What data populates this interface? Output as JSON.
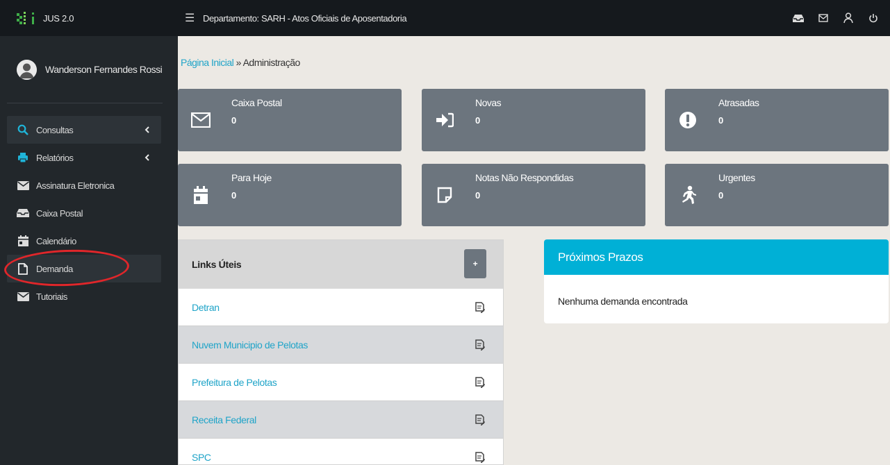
{
  "app": {
    "title": "JUS 2.0"
  },
  "header": {
    "department": "Departamento: SARH - Atos Oficiais de Aposentadoria"
  },
  "user": {
    "name": "Wanderson Fernandes Rossi"
  },
  "sidebar": {
    "items": [
      {
        "label": "Consultas",
        "icon": "search-icon"
      },
      {
        "label": "Relatórios",
        "icon": "printer-icon"
      },
      {
        "label": "Assinatura Eletronica",
        "icon": "envelope-icon"
      },
      {
        "label": "Caixa Postal",
        "icon": "inbox-icon"
      },
      {
        "label": "Calendário",
        "icon": "calendar-icon"
      },
      {
        "label": "Demanda",
        "icon": "document-icon"
      },
      {
        "label": "Tutoriais",
        "icon": "envelope-icon"
      }
    ]
  },
  "breadcrumb": {
    "home": "Página Inicial",
    "separator": " » ",
    "current": "Administração"
  },
  "cards": [
    {
      "title": "Caixa Postal",
      "value": "0",
      "icon": "envelope-icon"
    },
    {
      "title": "Novas",
      "value": "0",
      "icon": "sign-in-icon"
    },
    {
      "title": "Atrasadas",
      "value": "0",
      "icon": "exclamation-icon"
    },
    {
      "title": "Para Hoje",
      "value": "0",
      "icon": "calendar-icon"
    },
    {
      "title": "Notas Não Respondidas",
      "value": "0",
      "icon": "sticky-note-icon"
    },
    {
      "title": "Urgentes",
      "value": "0",
      "icon": "running-icon"
    }
  ],
  "links": {
    "title": "Links Úteis",
    "add_label": "+",
    "items": [
      {
        "label": "Detran"
      },
      {
        "label": "Nuvem Municipio de Pelotas"
      },
      {
        "label": "Prefeitura de Pelotas"
      },
      {
        "label": "Receita Federal"
      },
      {
        "label": "SPC"
      }
    ]
  },
  "prazos": {
    "title": "Próximos Prazos",
    "empty": "Nenhuma demanda encontrada"
  },
  "colors": {
    "topbar": "#15191d",
    "sidebar": "#22272b",
    "card": "#6c757e",
    "accent": "#00b0d6",
    "link": "#1fa4c8",
    "highlight": "#e0262a"
  }
}
